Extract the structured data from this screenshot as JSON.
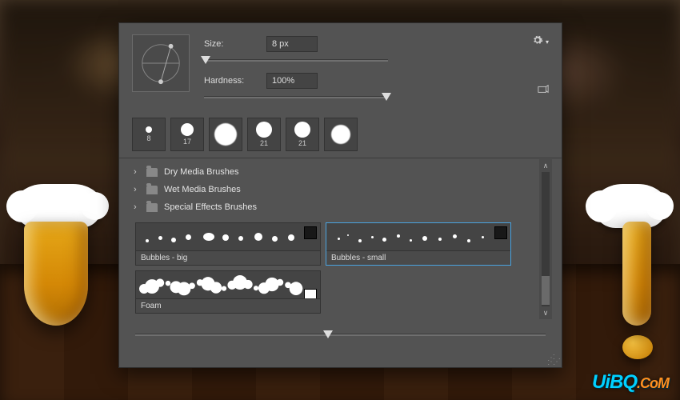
{
  "panel": {
    "size_label": "Size:",
    "size_value": "8 px",
    "hardness_label": "Hardness:",
    "hardness_value": "100%",
    "presets": [
      {
        "size": 8,
        "diameter": 8
      },
      {
        "size": 17,
        "diameter": 16
      },
      {
        "size": null,
        "diameter": 28
      },
      {
        "size": 21,
        "diameter": 20
      },
      {
        "size": 21,
        "diameter": 20
      },
      {
        "size": null,
        "diameter": 24
      }
    ],
    "folders": [
      {
        "label": "Dry Media Brushes"
      },
      {
        "label": "Wet Media Brushes"
      },
      {
        "label": "Special Effects Brushes"
      }
    ],
    "brushes": [
      {
        "label": "Bubbles - big",
        "selected": false,
        "kind": "bubbles-big"
      },
      {
        "label": "Bubbles - small",
        "selected": true,
        "kind": "bubbles-small"
      },
      {
        "label": "Foam",
        "selected": false,
        "kind": "foam"
      }
    ]
  },
  "icons": {
    "gear": "gear-icon",
    "flyout": "flyout-icon",
    "chevron": "›"
  },
  "watermark": {
    "main": "UiBQ",
    "suffix": ".CoM"
  }
}
